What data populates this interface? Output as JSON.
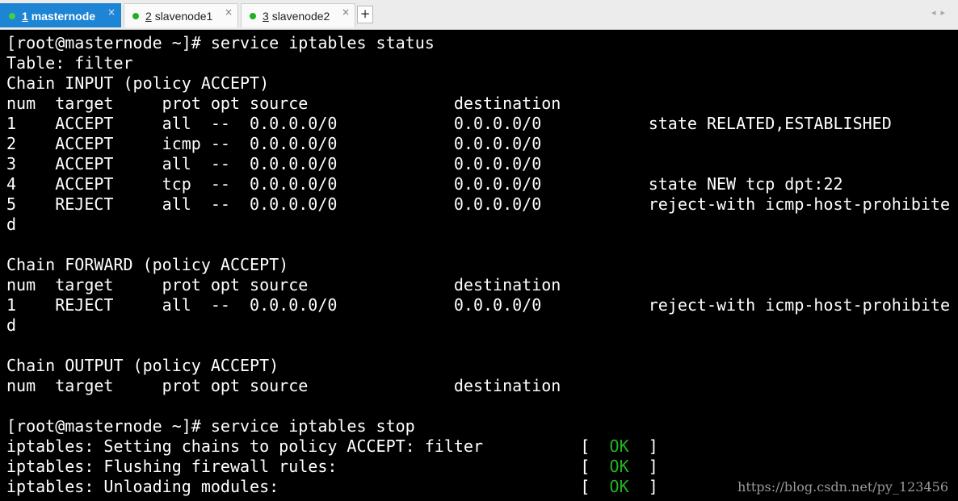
{
  "tabs": [
    {
      "number": "1",
      "name": "masternode",
      "active": true
    },
    {
      "number": "2",
      "name": "slavenode1",
      "active": false
    },
    {
      "number": "3",
      "name": "slavenode2",
      "active": false
    }
  ],
  "tab_close_glyph": "×",
  "new_tab_label": "+",
  "scroll_arrows": "◂▸",
  "terminal": {
    "lines": [
      "[root@masternode ~]# service iptables status",
      "Table: filter",
      "Chain INPUT (policy ACCEPT)",
      "num  target     prot opt source               destination",
      "1    ACCEPT     all  --  0.0.0.0/0            0.0.0.0/0           state RELATED,ESTABLISHED",
      "2    ACCEPT     icmp --  0.0.0.0/0            0.0.0.0/0",
      "3    ACCEPT     all  --  0.0.0.0/0            0.0.0.0/0",
      "4    ACCEPT     tcp  --  0.0.0.0/0            0.0.0.0/0           state NEW tcp dpt:22",
      "5    REJECT     all  --  0.0.0.0/0            0.0.0.0/0           reject-with icmp-host-prohibite",
      "d",
      "",
      "Chain FORWARD (policy ACCEPT)",
      "num  target     prot opt source               destination",
      "1    REJECT     all  --  0.0.0.0/0            0.0.0.0/0           reject-with icmp-host-prohibite",
      "d",
      "",
      "Chain OUTPUT (policy ACCEPT)",
      "num  target     prot opt source               destination",
      "",
      "[root@masternode ~]# service iptables stop"
    ],
    "status_lines": [
      {
        "text": "iptables: Setting chains to policy ACCEPT: filter          [  ",
        "ok": "OK",
        "tail": "  ]"
      },
      {
        "text": "iptables: Flushing firewall rules:                         [  ",
        "ok": "OK",
        "tail": "  ]"
      },
      {
        "text": "iptables: Unloading modules:                               [  ",
        "ok": "OK",
        "tail": "  ]"
      }
    ]
  },
  "watermark": "https://blog.csdn.net/py_123456",
  "colors": {
    "active_tab": "#1e84d4",
    "terminal_bg": "#000000",
    "terminal_fg": "#ffffff",
    "ok_green": "#22b322"
  }
}
